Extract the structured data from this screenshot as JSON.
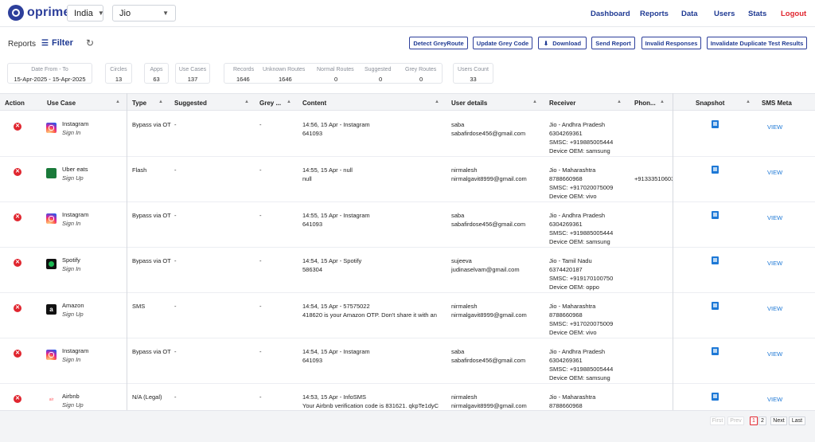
{
  "app": {
    "name": "oprimes"
  },
  "selectors": {
    "country": "India",
    "operator": "Jio"
  },
  "nav": {
    "dashboard": "Dashboard",
    "reports": "Reports",
    "data": "Data",
    "users": "Users",
    "stats": "Stats",
    "logout": "Logout"
  },
  "toolbar": {
    "reports_label": "Reports",
    "filter_label": "Filter",
    "buttons": {
      "detect": "Detect GreyRoute",
      "update": "Update Grey Code",
      "download": "Download",
      "send": "Send Report",
      "invalid": "Invalid Responses",
      "invalidate": "Invalidate Duplicate Test Results"
    }
  },
  "stats": {
    "date": {
      "label": "Date From - To",
      "value": "15-Apr-2025 - 15-Apr-2025"
    },
    "circles": {
      "label": "Circles",
      "value": "13"
    },
    "apps": {
      "label": "Apps",
      "value": "63"
    },
    "usecases": {
      "label": "Use Cases",
      "value": "137"
    },
    "records": {
      "label": "Records",
      "value": "1646"
    },
    "unknown": {
      "label": "Unknown Routes",
      "value": "1646"
    },
    "normal": {
      "label": "Normal Routes",
      "value": "0"
    },
    "suggested": {
      "label": "Suggested",
      "value": "0"
    },
    "grey": {
      "label": "Grey Routes",
      "value": "0"
    },
    "users": {
      "label": "Users Count",
      "value": "33"
    }
  },
  "colors": {
    "brand": "#2d3f9b",
    "link": "#1f3a93",
    "danger": "#e0262f",
    "success": "#1a9b2a",
    "view": "#1d78d6"
  },
  "table": {
    "headers": {
      "action": "Action",
      "usecase": "Use Case",
      "type": "Type",
      "suggested": "Suggested",
      "grey": "Grey ...",
      "content": "Content",
      "user": "User details",
      "receiver": "Receiver",
      "phone": "Phon...",
      "snapshot": "Snapshot",
      "smsmeta": "SMS Meta"
    },
    "rows": [
      {
        "icon": "instagram",
        "app": "Instagram",
        "usecase": "Sign In",
        "type": "Bypass via OT",
        "suggested": "-",
        "grey": "-",
        "content1": "14:56, 15 Apr - Instagram",
        "content2": "641093",
        "user1": "saba",
        "user2": "sabafirdose456@gmail.com",
        "rcv1": "Jio - Andhra Pradesh",
        "rcv2": "6304269361",
        "rcv3": "SMSC: +919885005444",
        "rcv4": "Device OEM: samsung",
        "phone": "",
        "view": "VIEW"
      },
      {
        "icon": "uber",
        "app": "Uber eats",
        "usecase": "Sign Up",
        "type": "Flash",
        "suggested": "-",
        "grey": "-",
        "content1": "14:55, 15 Apr - null",
        "content2": "null",
        "user1": "nirmalesh",
        "user2": "nirmalgavit8999@gmail.com",
        "rcv1": "Jio - Maharashtra",
        "rcv2": "8788660968",
        "rcv3": "SMSC: +917020075009",
        "rcv4": "Device OEM: vivo",
        "phone": "+91333510603",
        "view": "VIEW"
      },
      {
        "icon": "instagram",
        "app": "Instagram",
        "usecase": "Sign In",
        "type": "Bypass via OT",
        "suggested": "-",
        "grey": "-",
        "content1": "14:55, 15 Apr - Instagram",
        "content2": "641093",
        "user1": "saba",
        "user2": "sabafirdose456@gmail.com",
        "rcv1": "Jio - Andhra Pradesh",
        "rcv2": "6304269361",
        "rcv3": "SMSC: +919885005444",
        "rcv4": "Device OEM: samsung",
        "phone": "",
        "view": "VIEW"
      },
      {
        "icon": "spotify",
        "app": "Spotify",
        "usecase": "Sign In",
        "type": "Bypass via OT",
        "suggested": "-",
        "grey": "-",
        "content1": "14:54, 15 Apr - Spotify",
        "content2": "586304",
        "user1": "sujeeva",
        "user2": "judinaselvam@gmail.com",
        "rcv1": "Jio - Tamil Nadu",
        "rcv2": "6374420187",
        "rcv3": "SMSC: +919170100750",
        "rcv4": "Device OEM: oppo",
        "phone": "",
        "view": "VIEW"
      },
      {
        "icon": "amazon",
        "app": "Amazon",
        "usecase": "Sign Up",
        "type": "SMS",
        "suggested": "-",
        "grey": "-",
        "content1": "14:54, 15 Apr - 57575022",
        "content2": "418620 is your Amazon OTP. Don't share it with an",
        "user1": "nirmalesh",
        "user2": "nirmalgavit8999@gmail.com",
        "rcv1": "Jio - Maharashtra",
        "rcv2": "8788660968",
        "rcv3": "SMSC: +917020075009",
        "rcv4": "Device OEM: vivo",
        "phone": "",
        "view": "VIEW"
      },
      {
        "icon": "instagram",
        "app": "Instagram",
        "usecase": "Sign In",
        "type": "Bypass via OT",
        "suggested": "-",
        "grey": "-",
        "content1": "14:54, 15 Apr - Instagram",
        "content2": "641093",
        "user1": "saba",
        "user2": "sabafirdose456@gmail.com",
        "rcv1": "Jio - Andhra Pradesh",
        "rcv2": "6304269361",
        "rcv3": "SMSC: +919885005444",
        "rcv4": "Device OEM: samsung",
        "phone": "",
        "view": "VIEW"
      },
      {
        "icon": "airbnb",
        "app": "Airbnb",
        "usecase": "Sign Up",
        "type": "N/A (Legal)",
        "suggested": "-",
        "grey": "-",
        "content1": "14:53, 15 Apr - InfoSMS",
        "content2": "Your Airbnb verification code is 831621. qkpTe1dyC",
        "user1": "nirmalesh",
        "user2": "nirmalgavit8999@gmail.com",
        "rcv1": "Jio - Maharashtra",
        "rcv2": "8788660968",
        "rcv3": "",
        "rcv4": "",
        "phone": "",
        "view": "VIEW"
      }
    ]
  },
  "pagination": {
    "first": "First",
    "prev": "Prev",
    "page1": "1",
    "page2": "2",
    "next": "Next",
    "last": "Last"
  }
}
